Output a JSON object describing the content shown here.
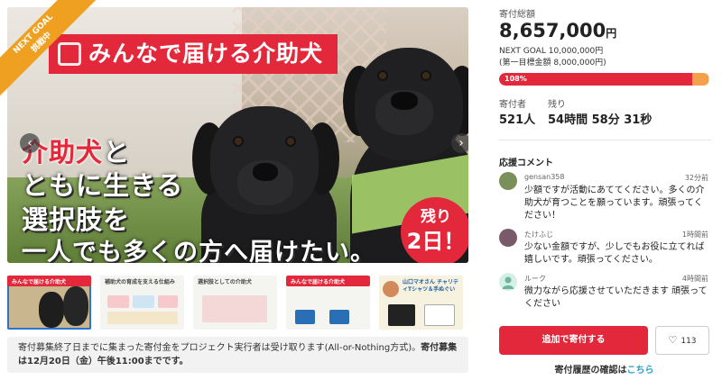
{
  "hero": {
    "ribbon_line1": "NEXT GOAL",
    "ribbon_line2": "挑戦中",
    "title": "みんなで届ける介助犬",
    "line1_red": "介助犬",
    "line1_rest": "と",
    "line2": "ともに生きる",
    "line3": "選択肢を",
    "line4": "一人でも多くの方へ届けたい。",
    "days_left_label": "残り",
    "days_left_value": "2日！",
    "prev_arrow": "‹",
    "next_arrow": "›"
  },
  "thumbnails": [
    {
      "title": "みんなで届ける介助犬",
      "active": true
    },
    {
      "title": "補助犬の育成を支える仕組み",
      "active": false
    },
    {
      "title": "選択肢としての介助犬",
      "active": false
    },
    {
      "title": "みんなで届ける介助犬",
      "active": false
    },
    {
      "title": "山口マオさん チャリティTシャツ＆手ぬぐい",
      "active": false
    }
  ],
  "notice": {
    "text_before": "寄付募集終了日までに集まった寄付金をプロジェクト実行者は受け取ります(All-or-Nothing方式)。",
    "text_bold": "寄付募集は12月20日（金）午後11:00までです。"
  },
  "funding": {
    "total_label": "寄付総額",
    "total_amount": "8,657,000",
    "currency": "円",
    "next_goal": "NEXT GOAL 10,000,000円",
    "first_goal": "(第一目標金額 8,000,000円)",
    "progress_text": "108%",
    "progress_percent": 108,
    "supporters_label": "寄付者",
    "supporters_value": "521人",
    "remaining_label": "残り",
    "remaining_value": "54時間 58分 31秒"
  },
  "comments": {
    "title": "応援コメント",
    "items": [
      {
        "name": "gensan358",
        "time": "32分前",
        "body": "少額ですが活動にあててください。多くの介助犬が育つことを願っています。頑張ってください！",
        "avatar_color": "#7a8f5a"
      },
      {
        "name": "たけふじ",
        "time": "1時間前",
        "body": "少ない金額ですが、少しでもお役に立てれば嬉しいです。頑張ってください。",
        "avatar_color": "#7a5a6a"
      },
      {
        "name": "ルーク",
        "time": "4時間前",
        "body": "微力ながら応援させていただきます 頑張ってください",
        "avatar_color": "#d6efe6"
      }
    ]
  },
  "actions": {
    "donate_label": "追加で寄付する",
    "like_icon": "♡",
    "like_count": "113",
    "history_text": "寄付履歴の確認は",
    "history_link": "こちら"
  },
  "colors": {
    "accent_red": "#e4283b",
    "ribbon_orange": "#f0a020",
    "link_blue": "#2a9ec0"
  }
}
